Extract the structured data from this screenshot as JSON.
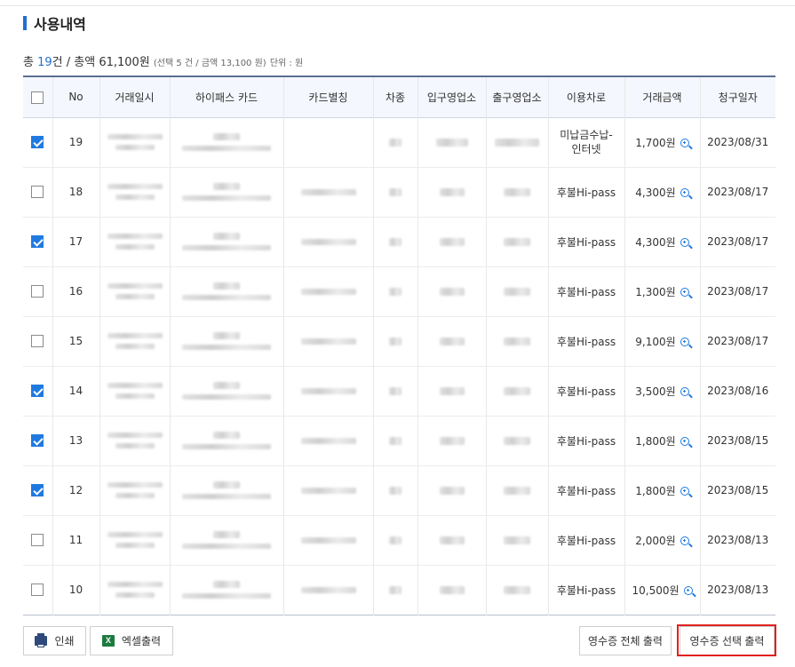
{
  "section": {
    "title": "사용내역"
  },
  "summary": {
    "prefix": "총 ",
    "count": "19",
    "count_suffix": "건 / 총액 ",
    "total": "61,100원",
    "selection": "(선택 5 건 / 금액 13,100 원)",
    "unit": "단위 : 원"
  },
  "table": {
    "headers": [
      "No",
      "거래일시",
      "하이패스 카드",
      "카드별칭",
      "차종",
      "입구영업소",
      "출구영업소",
      "이용차로",
      "거래금액",
      "청구일자"
    ],
    "rows": [
      {
        "checked": true,
        "no": "19",
        "lane": "미납금수납-\n인터넷",
        "amount": "1,700원",
        "date": "2023/08/31"
      },
      {
        "checked": false,
        "no": "18",
        "lane": "후불Hi-pass",
        "amount": "4,300원",
        "date": "2023/08/17"
      },
      {
        "checked": true,
        "no": "17",
        "lane": "후불Hi-pass",
        "amount": "4,300원",
        "date": "2023/08/17"
      },
      {
        "checked": false,
        "no": "16",
        "lane": "후불Hi-pass",
        "amount": "1,300원",
        "date": "2023/08/17"
      },
      {
        "checked": false,
        "no": "15",
        "lane": "후불Hi-pass",
        "amount": "9,100원",
        "date": "2023/08/17"
      },
      {
        "checked": true,
        "no": "14",
        "lane": "후불Hi-pass",
        "amount": "3,500원",
        "date": "2023/08/16"
      },
      {
        "checked": true,
        "no": "13",
        "lane": "후불Hi-pass",
        "amount": "1,800원",
        "date": "2023/08/15"
      },
      {
        "checked": true,
        "no": "12",
        "lane": "후불Hi-pass",
        "amount": "1,800원",
        "date": "2023/08/15"
      },
      {
        "checked": false,
        "no": "11",
        "lane": "후불Hi-pass",
        "amount": "2,000원",
        "date": "2023/08/13"
      },
      {
        "checked": false,
        "no": "10",
        "lane": "후불Hi-pass",
        "amount": "10,500원",
        "date": "2023/08/13"
      }
    ]
  },
  "buttons": {
    "print": "인쇄",
    "excel": "엑셀출력",
    "receipt_all": "영수증 전체 출력",
    "receipt_selected": "영수증 선택 출력"
  },
  "icons": {
    "print": "printer-icon",
    "excel": "excel-icon",
    "zoom": "zoom-in-icon"
  },
  "colors": {
    "accent": "#1f6fd1",
    "checkbox_on": "#1f7ae0",
    "highlight_border": "#e0211f",
    "header_bg": "#f4f7fd"
  }
}
